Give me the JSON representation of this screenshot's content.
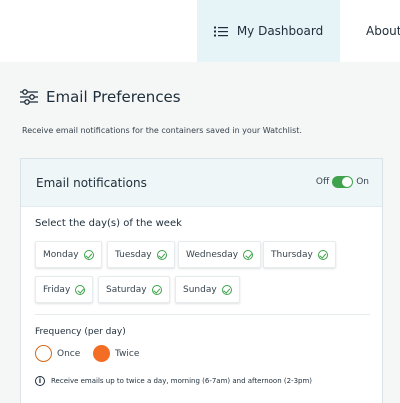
{
  "nav": {
    "dashboard_label": "My Dashboard",
    "about_label": "About"
  },
  "page": {
    "title": "Email Preferences",
    "subtitle": "Receive email notifications for the containers saved in your Watchlist."
  },
  "notifications": {
    "title": "Email notifications",
    "toggle_off_label": "Off",
    "toggle_on_label": "On",
    "toggle_state": "on"
  },
  "days": {
    "title": "Select the day(s) of the week",
    "items": [
      {
        "label": "Monday",
        "checked": true
      },
      {
        "label": "Tuesday",
        "checked": true
      },
      {
        "label": "Wednesday",
        "checked": true
      },
      {
        "label": "Thursday",
        "checked": true
      },
      {
        "label": "Friday",
        "checked": true
      },
      {
        "label": "Saturday",
        "checked": true
      },
      {
        "label": "Sunday",
        "checked": true
      }
    ]
  },
  "frequency": {
    "title": "Frequency (per day)",
    "options": [
      {
        "label": "Once",
        "selected": false
      },
      {
        "label": "Twice",
        "selected": true
      }
    ]
  },
  "info": {
    "text": "Receive emails up to twice a day, morning (6-7am) and afternoon (2-3pm)"
  },
  "colors": {
    "accent_green": "#3fa34d",
    "accent_orange": "#f36d25",
    "nav_active_bg": "#e6f3f7"
  }
}
